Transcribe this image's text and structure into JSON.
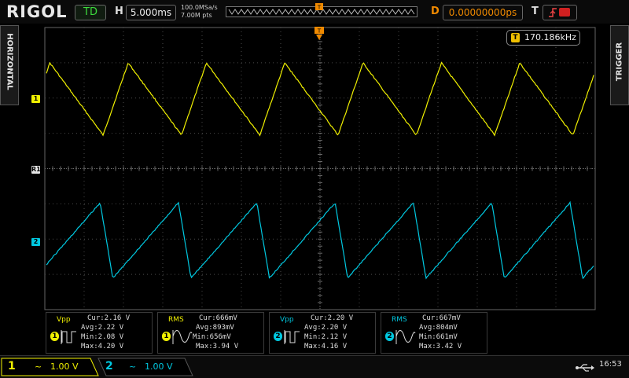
{
  "brand": "RIGOL",
  "status": "TD",
  "horizontal": {
    "label": "H",
    "timebase": "5.000ms",
    "sample_rate": "100.0MSa/s",
    "memory_depth": "7.00M pts"
  },
  "delay": {
    "label": "D",
    "value": "0.00000000ps"
  },
  "trigger_bar": {
    "label": "T",
    "edge_icon": "rising-edge-icon",
    "source_color": "#d02020"
  },
  "side_tabs": {
    "left": "HORIZONTAL",
    "right": "TRIGGER"
  },
  "markers": {
    "ch1": "1",
    "ch2": "2",
    "ref": "R1",
    "trigger_position": "T"
  },
  "frequency": {
    "icon": "T",
    "value": "170.186kHz"
  },
  "measurements": [
    {
      "name": "Vpp",
      "channel": "1",
      "color": "#f0f000",
      "icon": "square-pulse-icon",
      "cur": "Cur:2.16 V",
      "avg": "Avg:2.22 V",
      "min": "Min:2.08 V",
      "max": "Max:4.20 V"
    },
    {
      "name": "RMS",
      "channel": "1",
      "color": "#f0f000",
      "icon": "sine-wave-icon",
      "cur": "Cur:666mV",
      "avg": "Avg:893mV",
      "min": "Min:656mV",
      "max": "Max:3.94 V"
    },
    {
      "name": "Vpp",
      "channel": "2",
      "color": "#00c8e0",
      "icon": "square-pulse-icon",
      "cur": "Cur:2.20 V",
      "avg": "Avg:2.20 V",
      "min": "Min:2.12 V",
      "max": "Max:4.16 V"
    },
    {
      "name": "RMS",
      "channel": "2",
      "color": "#00c8e0",
      "icon": "sine-wave-icon",
      "cur": "Cur:667mV",
      "avg": "Avg:804mV",
      "min": "Min:661mV",
      "max": "Max:3.42 V"
    }
  ],
  "channels": [
    {
      "num": "1",
      "coupling": "~",
      "scale": "1.00 V",
      "color": "#f0f000",
      "active": true
    },
    {
      "num": "2",
      "coupling": "~",
      "scale": "1.00 V",
      "color": "#00c8e0",
      "active": false
    }
  ],
  "clock": "16:53",
  "usb_icon": "usb-icon",
  "colors": {
    "ch1": "#f0f000",
    "ch2": "#00c8e0",
    "grid": "#4a4a4a",
    "accent": "#f08a00"
  }
}
